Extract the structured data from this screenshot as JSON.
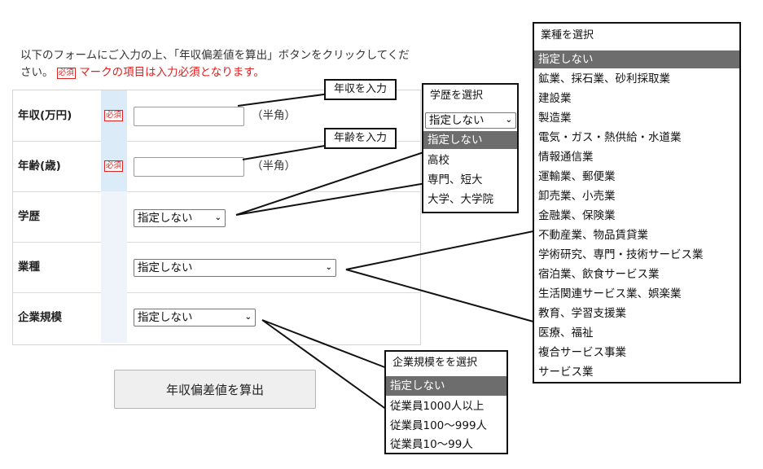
{
  "intro": {
    "text_before": "以下のフォームにご入力の上、「年収偏差値を算出」ボタンをクリックしてください。",
    "required_badge": "必須",
    "required_note": "マークの項目は入力必須となります。"
  },
  "form": {
    "rows": [
      {
        "label": "年収(万円)",
        "required": "必須",
        "unit": "（半角）"
      },
      {
        "label": "年齢(歳)",
        "required": "必須",
        "unit": "（半角）"
      },
      {
        "label": "学歴",
        "selected": "指定しない"
      },
      {
        "label": "業種",
        "selected": "指定しない"
      },
      {
        "label": "企業規模",
        "selected": "指定しない"
      }
    ],
    "submit_label": "年収偏差値を算出"
  },
  "callouts": {
    "income_hint": "年収を入力",
    "age_hint": "年齢を入力",
    "education": {
      "title": "学歴を選択",
      "selected": "指定しない",
      "options": [
        "指定しない",
        "高校",
        "専門、短大",
        "大学、大学院"
      ]
    },
    "industry": {
      "title": "業種を選択",
      "options": [
        "指定しない",
        "鉱業、採石業、砂利採取業",
        "建設業",
        "製造業",
        "電気・ガス・熱供給・水道業",
        "情報通信業",
        "運輸業、郵便業",
        "卸売業、小売業",
        "金融業、保険業",
        "不動産業、物品賃貸業",
        "学術研究、専門・技術サービス業",
        "宿泊業、飲食サービス業",
        "生活関連サービス業、娯楽業",
        "教育、学習支援業",
        "医療、福祉",
        "複合サービス事業",
        "サービス業"
      ]
    },
    "company_size": {
      "title": "企業規模をを選択",
      "options": [
        "指定しない",
        "従業員1000人以上",
        "従業員100〜999人",
        "従業員10〜99人"
      ]
    }
  }
}
